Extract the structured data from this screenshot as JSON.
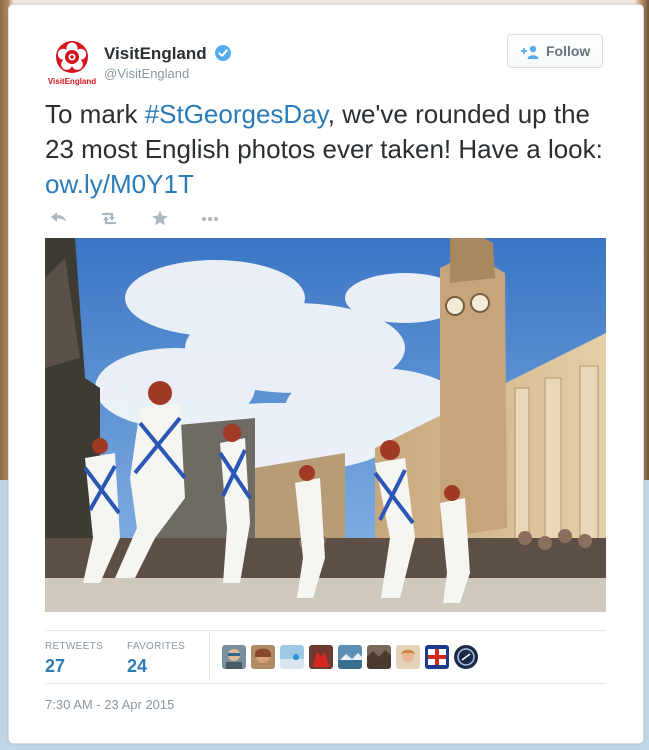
{
  "tweet": {
    "display_name": "VisitEngland",
    "handle": "@VisitEngland",
    "avatar_caption": "VisitEngland",
    "follow_label": "Follow",
    "text_before_hashtag": "To mark ",
    "hashtag": "#StGeorgesDay",
    "text_middle": ", we've rounded up the 23 most English photos ever taken! Have a look: ",
    "link": "ow.ly/M0Y1T",
    "timestamp": "7:30 AM - 23 Apr 2015"
  },
  "stats": {
    "retweets_label": "RETWEETS",
    "retweets_value": "27",
    "favorites_label": "FAVORITES",
    "favorites_value": "24"
  },
  "icons": {
    "actions": [
      "reply-icon",
      "retweet-icon",
      "favorite-star-icon",
      "more-icon"
    ],
    "follow": "add-user-icon",
    "verified": "verified-badge-icon"
  },
  "colors": {
    "link": "#2b7bb9",
    "text": "#292f33",
    "muted": "#8899a6",
    "verified": "#55acee"
  }
}
